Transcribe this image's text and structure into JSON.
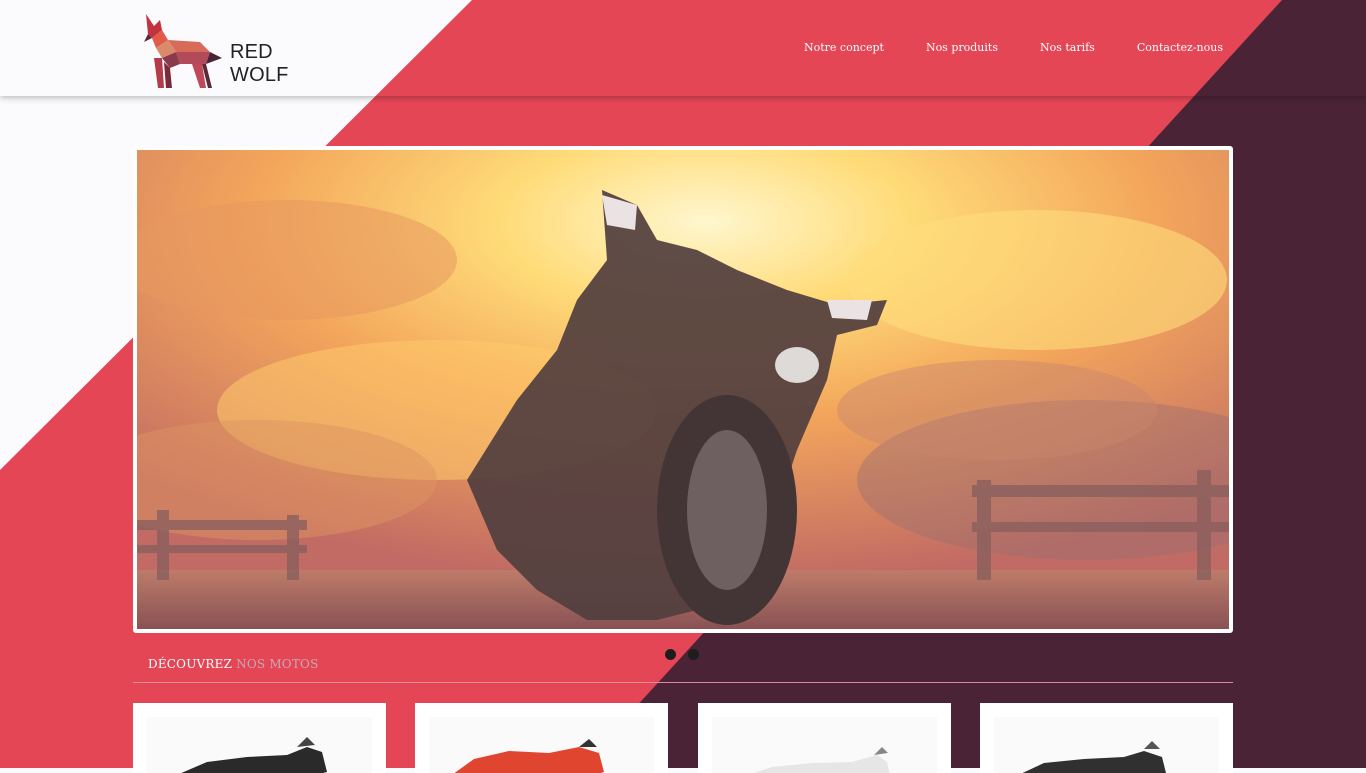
{
  "brand": {
    "name": "RED WOLF"
  },
  "nav": {
    "items": [
      {
        "label": "Notre concept"
      },
      {
        "label": "Nos produits"
      },
      {
        "label": "Nos tarifs"
      },
      {
        "label": "Contactez-nous"
      }
    ]
  },
  "slider": {
    "slides_count": 2,
    "active_slide": 2
  },
  "section": {
    "title_strong": "DÉCOUVREZ",
    "title_light": "NOS MOTOS"
  },
  "products": [
    {
      "icon": "motorcycle-black-icon"
    },
    {
      "icon": "motorcycle-red-icon"
    },
    {
      "icon": "motorcycle-white-icon"
    },
    {
      "icon": "motorcycle-dark-icon"
    }
  ],
  "colors": {
    "red": "#e44656",
    "plum": "#4a2436",
    "white": "#fbfbfd"
  }
}
